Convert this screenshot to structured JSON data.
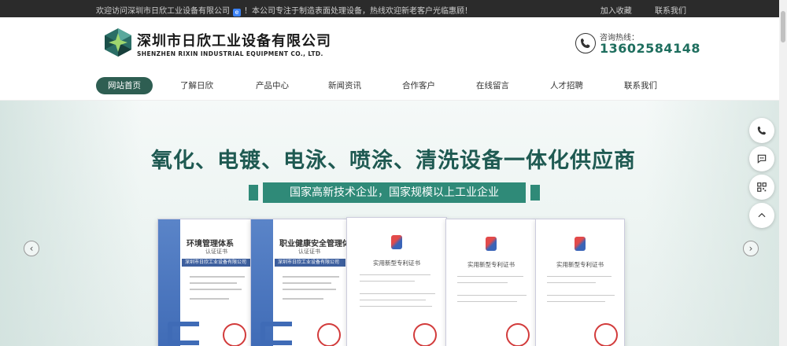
{
  "topbar": {
    "welcome": "欢迎访问深圳市日欣工业设备有限公司",
    "badge": "e",
    "notice": "！本公司专注于制造表面处理设备，热线欢迎新老客户光临惠顾！",
    "links": [
      "加入收藏",
      "联系我们"
    ]
  },
  "header": {
    "company_cn": "深圳市日欣工业设备有限公司",
    "company_en": "SHENZHEN RIXIN INDUSTRIAL EQUIPMENT CO., LTD.",
    "hotline_label": "咨询热线：",
    "hotline_number": "13602584148"
  },
  "nav": {
    "items": [
      "网站首页",
      "了解日欣",
      "产品中心",
      "新闻资讯",
      "合作客户",
      "在线留言",
      "人才招聘",
      "联系我们"
    ],
    "active": "网站首页"
  },
  "banner": {
    "headline": "氧化、电镀、电泳、喷涂、清洗设备一体化供应商",
    "ribbon": "国家高新技术企业，国家规模以上工业企业",
    "certificates": [
      {
        "title": "环境管理体系",
        "subtitle": "认证证书",
        "company": "深圳市日欣工业设备有限公司"
      },
      {
        "title": "职业健康安全管理体系",
        "subtitle": "认证证书",
        "company": "深圳市日欣工业设备有限公司"
      }
    ],
    "patents": [
      {
        "title": "实用新型专利证书"
      },
      {
        "title": "实用新型专利证书"
      },
      {
        "title": "实用新型专利证书"
      }
    ]
  },
  "float_icons": [
    "phone-icon",
    "chat-icon",
    "qrcode-icon",
    "back-to-top-icon"
  ],
  "colors": {
    "brand": "#2e5e52",
    "accent": "#2f8a78",
    "hotline": "#1e6e5e"
  }
}
